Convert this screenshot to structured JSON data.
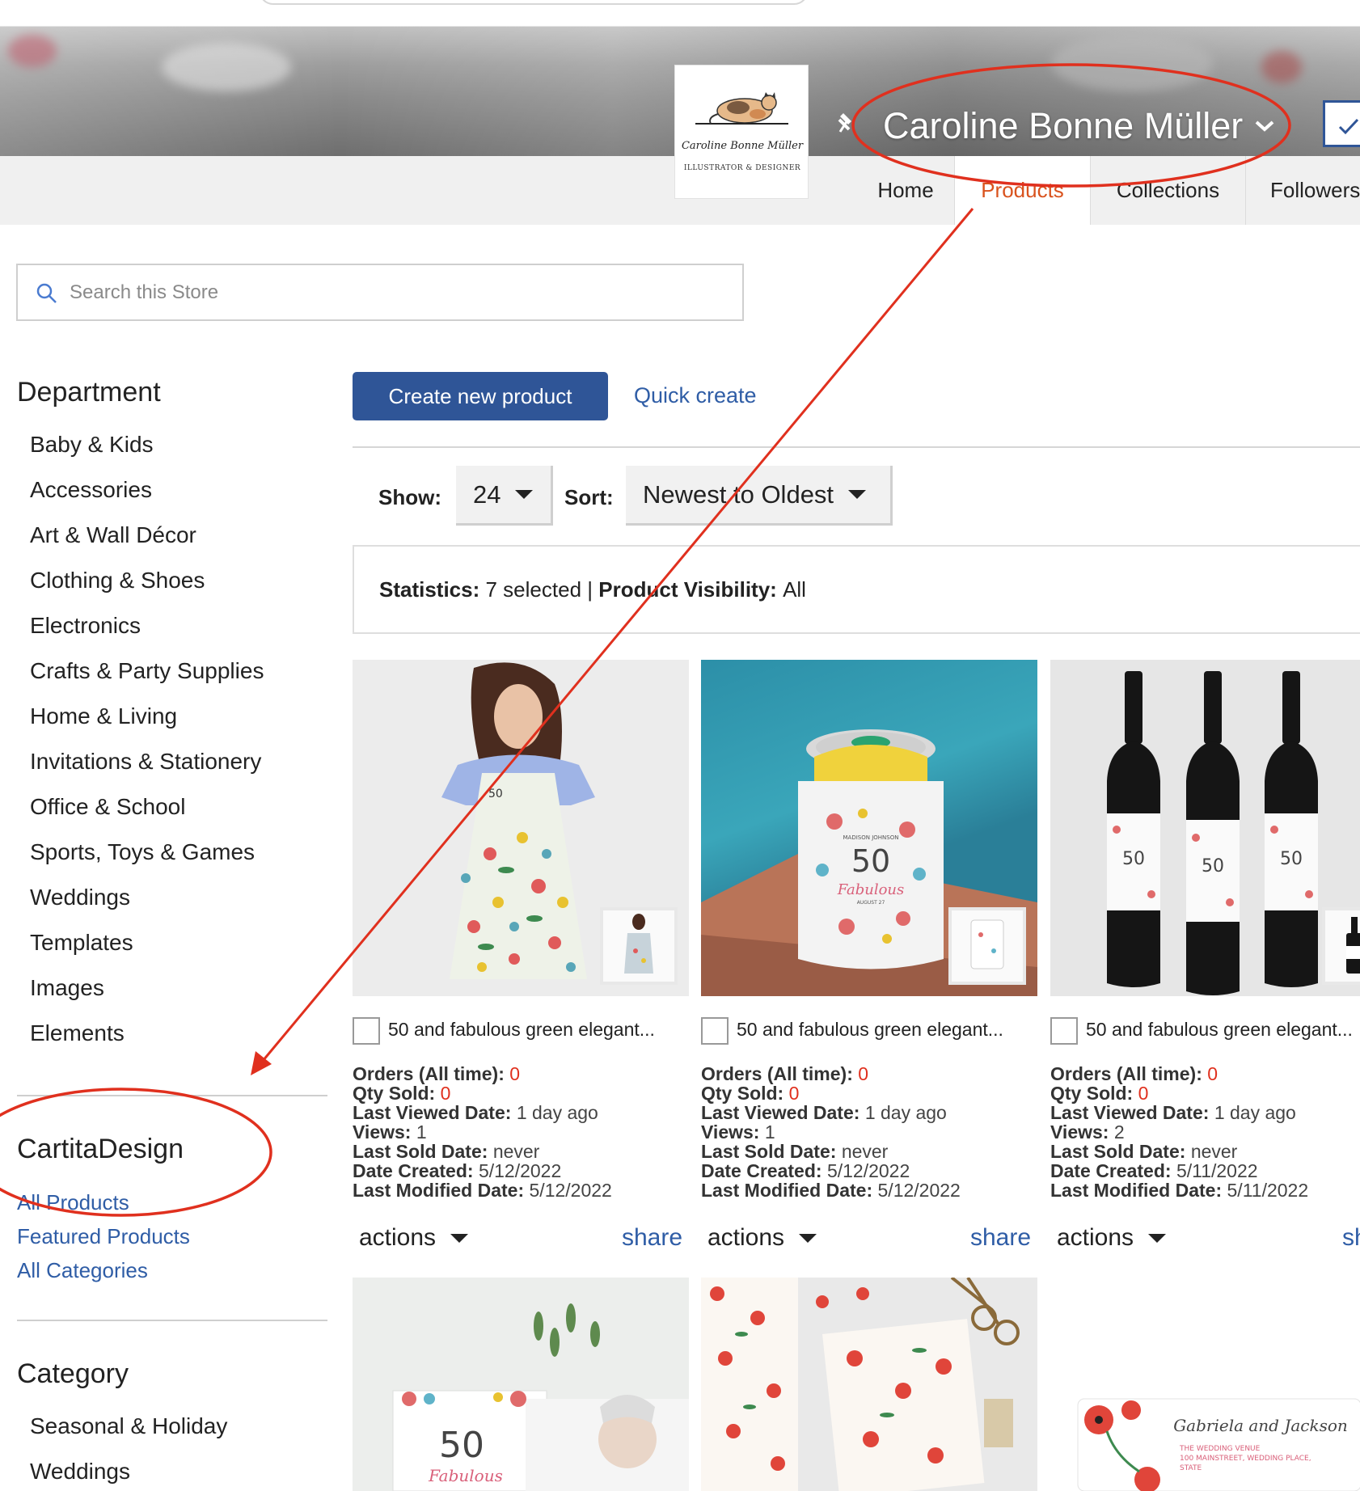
{
  "store": {
    "name": "Caroline Bonne Müller",
    "logo_name": "Caroline Bonne Müller",
    "logo_sub": "ILLUSTRATOR & DESIGNER"
  },
  "nav": {
    "tabs": [
      "Home",
      "Products",
      "Collections",
      "Followers"
    ],
    "active": "Products"
  },
  "search": {
    "placeholder": "Search this Store"
  },
  "department": {
    "heading": "Department",
    "items": [
      "Baby & Kids",
      "Accessories",
      "Art & Wall Décor",
      "Clothing & Shoes",
      "Electronics",
      "Crafts & Party Supplies",
      "Home & Living",
      "Invitations & Stationery",
      "Office & School",
      "Sports, Toys & Games",
      "Weddings",
      "Templates",
      "Images",
      "Elements"
    ]
  },
  "storeblock": {
    "heading": "CartitaDesign",
    "links": [
      "All Products",
      "Featured Products",
      "All Categories"
    ]
  },
  "category": {
    "heading": "Category",
    "items": [
      "Seasonal & Holiday",
      "Weddings"
    ]
  },
  "toolbar": {
    "create_label": "Create new product",
    "quick_label": "Quick create",
    "show_label": "Show:",
    "show_value": "24",
    "sort_label": "Sort:",
    "sort_value": "Newest to Oldest"
  },
  "stats": {
    "statistics_label": "Statistics:",
    "statistics_value": "7 selected",
    "separator": "|",
    "visibility_label": "Product Visibility:",
    "visibility_value": "All"
  },
  "stat_labels": {
    "orders": "Orders (All time):",
    "qty": "Qty Sold:",
    "last_viewed": "Last Viewed Date:",
    "views": "Views:",
    "last_sold": "Last Sold Date:",
    "created": "Date Created:",
    "modified": "Last Modified Date:"
  },
  "products": [
    {
      "title": "50 and fabulous green elegant...",
      "orders": "0",
      "qty": "0",
      "last_viewed": "1 day ago",
      "views": "1",
      "last_sold": "never",
      "created": "5/12/2022",
      "modified": "5/12/2022",
      "actions": "actions",
      "share": "share",
      "image": "apron"
    },
    {
      "title": "50 and fabulous green elegant...",
      "orders": "0",
      "qty": "0",
      "last_viewed": "1 day ago",
      "views": "1",
      "last_sold": "never",
      "created": "5/12/2022",
      "modified": "5/12/2022",
      "actions": "actions",
      "share": "share",
      "image": "can-cooler"
    },
    {
      "title": "50 and fabulous green elegant...",
      "orders": "0",
      "qty": "0",
      "last_viewed": "1 day ago",
      "views": "2",
      "last_sold": "never",
      "created": "5/11/2022",
      "modified": "5/11/2022",
      "actions": "actions",
      "share": "share",
      "image": "wine-bottles"
    }
  ],
  "bottom_row": [
    {
      "image": "invitation",
      "number": "50",
      "script": "Fabulous"
    },
    {
      "image": "wrapping-paper"
    },
    {
      "image": "address-label",
      "script": "Gabriela and Jackson",
      "lines": [
        "THE WEDDING VENUE",
        "100 MAINSTREET, WEDDING PLACE,",
        "STATE"
      ]
    }
  ],
  "card_texts": {
    "number": "50",
    "script": "Fabulous",
    "name": "MADISON JOHNSON",
    "date": "AUGUST 27"
  },
  "colors": {
    "accent_blue": "#2f5597",
    "link_blue": "#2f5da6",
    "active_tab": "#d9531e",
    "annotation_red": "#e0301e"
  }
}
